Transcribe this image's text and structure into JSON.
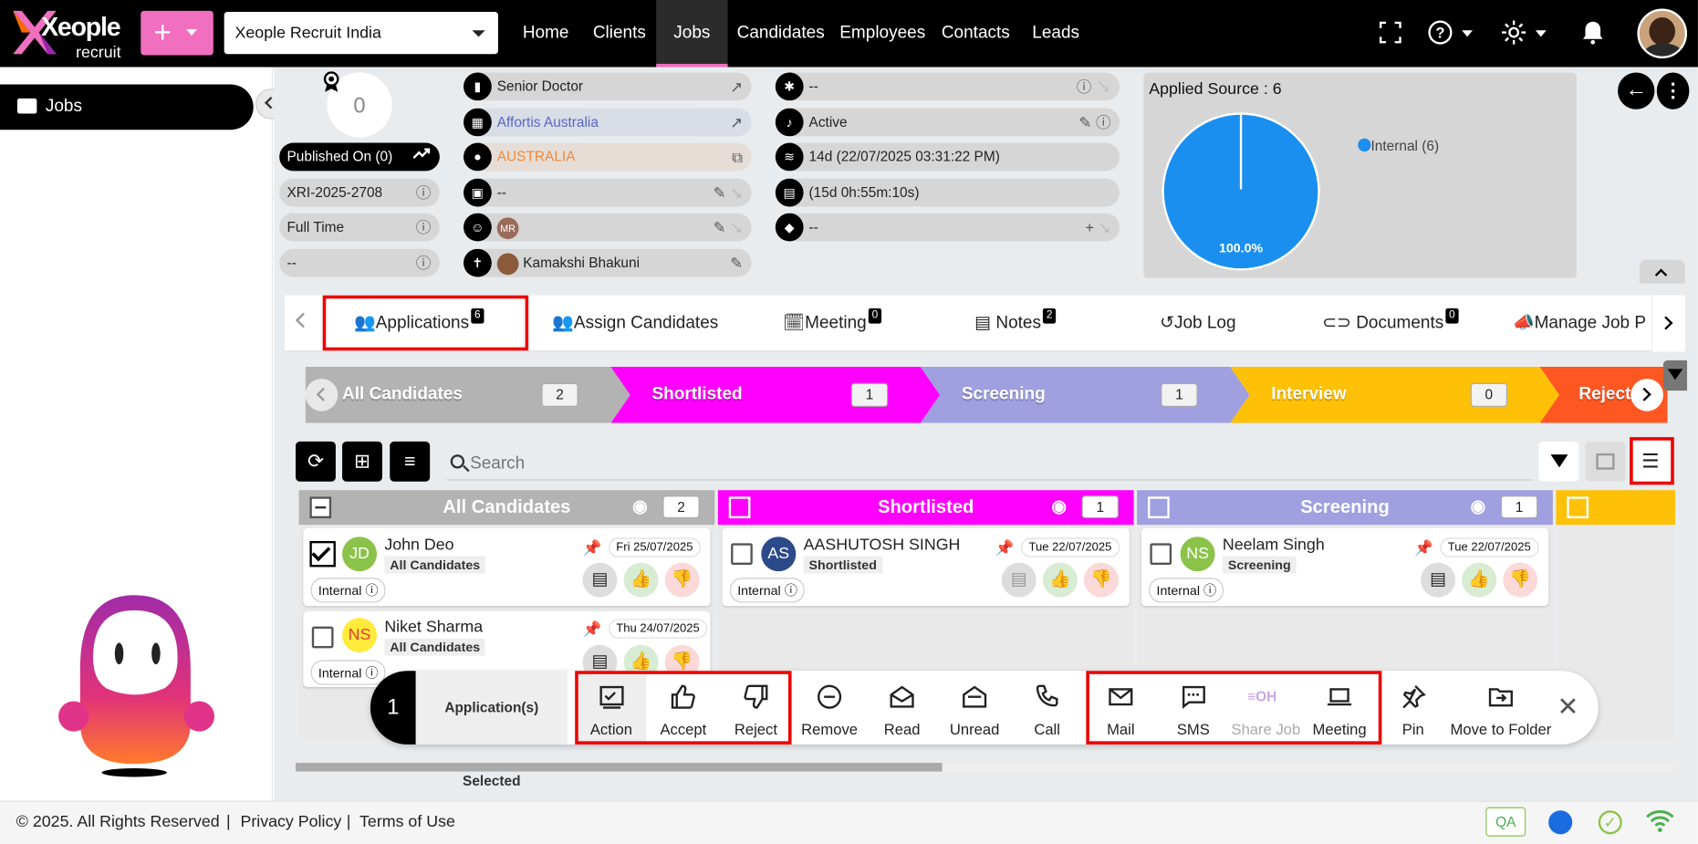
{
  "app": {
    "logo_text": "Xeople",
    "logo_sub": "recruit",
    "plus_label": "+",
    "org_selector": "Xeople Recruit India",
    "nav": [
      "Home",
      "Clients",
      "Jobs",
      "Candidates",
      "Employees",
      "Contacts",
      "Leads"
    ],
    "active_nav": "Jobs"
  },
  "sidebar": {
    "items": [
      {
        "label": "Jobs",
        "icon": "briefcase-icon"
      }
    ]
  },
  "job": {
    "score": "0",
    "published": "Published On (0)",
    "job_code": "XRI-2025-2708",
    "job_type": "Full Time",
    "extra": "--",
    "title": "Senior Doctor",
    "client": "Affortis Australia",
    "location": "AUSTRALIA",
    "field4": "--",
    "owner": "Kamakshi Bhakuni",
    "owner_initials": "MR",
    "c2_field1": "--",
    "status": "Active",
    "age": "14d (22/07/2025 03:31:22 PM)",
    "remaining": "(15d 0h:55m:10s)",
    "tags": "--"
  },
  "applied_source": {
    "title": "Applied Source : 6",
    "legend": "Internal (6)",
    "pct": "100.0%",
    "color": "#1a8ff0"
  },
  "tabs": [
    {
      "label": "Applications",
      "badge": "6",
      "icon": "users-icon"
    },
    {
      "label": "Assign Candidates",
      "badge": "",
      "icon": "user-add-icon"
    },
    {
      "label": "Meeting",
      "badge": "0",
      "icon": "star-calendar-icon"
    },
    {
      "label": "Notes",
      "badge": "2",
      "icon": "note-icon"
    },
    {
      "label": "Job Log",
      "badge": "",
      "icon": "history-icon"
    },
    {
      "label": "Documents",
      "badge": "0",
      "icon": "paperclip-icon"
    },
    {
      "label": "Manage Job P",
      "badge": "",
      "icon": "megaphone-icon"
    }
  ],
  "stages": [
    {
      "label": "All Candidates",
      "count": "2",
      "color": "#b3b3b3"
    },
    {
      "label": "Shortlisted",
      "count": "1",
      "color": "#ff00ff"
    },
    {
      "label": "Screening",
      "count": "1",
      "color": "#a09fe0"
    },
    {
      "label": "Interview",
      "count": "0",
      "color": "#ffc107"
    },
    {
      "label": "Reject",
      "count": "",
      "color": "#ff5722"
    }
  ],
  "search": {
    "placeholder": "Search"
  },
  "columns": [
    {
      "title": "All Candidates",
      "count": "2",
      "color": "#b3b3b3"
    },
    {
      "title": "Shortlisted",
      "count": "1",
      "color": "#ff00ff"
    },
    {
      "title": "Screening",
      "count": "1",
      "color": "#a09fe0"
    }
  ],
  "cards": [
    {
      "name": "John Deo",
      "initials": "JD",
      "stage": "All Candidates",
      "date": "Fri 25/07/2025",
      "source": "Internal",
      "checked": true
    },
    {
      "name": "Niket Sharma",
      "initials": "NS",
      "stage": "All Candidates",
      "date": "Thu 24/07/2025",
      "source": "Internal",
      "checked": false
    },
    {
      "name": "AASHUTOSH SINGH",
      "initials": "AS",
      "stage": "Shortlisted",
      "date": "Tue 22/07/2025",
      "source": "Internal",
      "checked": false
    },
    {
      "name": "Neelam Singh",
      "initials": "NS",
      "stage": "Screening",
      "date": "Tue 22/07/2025",
      "source": "Internal",
      "checked": false
    }
  ],
  "selection": {
    "count": "1",
    "label": "Application(s) Selected",
    "actions": [
      "Action",
      "Accept",
      "Reject",
      "Remove",
      "Read",
      "Unread",
      "Call",
      "Mail",
      "SMS",
      "Share Job",
      "Meeting",
      "Pin",
      "Move to Folder"
    ]
  },
  "footer": {
    "copyright": "© 2025. All Rights Reserved",
    "privacy": "Privacy Policy",
    "terms": "Terms of Use",
    "env": "QA"
  }
}
